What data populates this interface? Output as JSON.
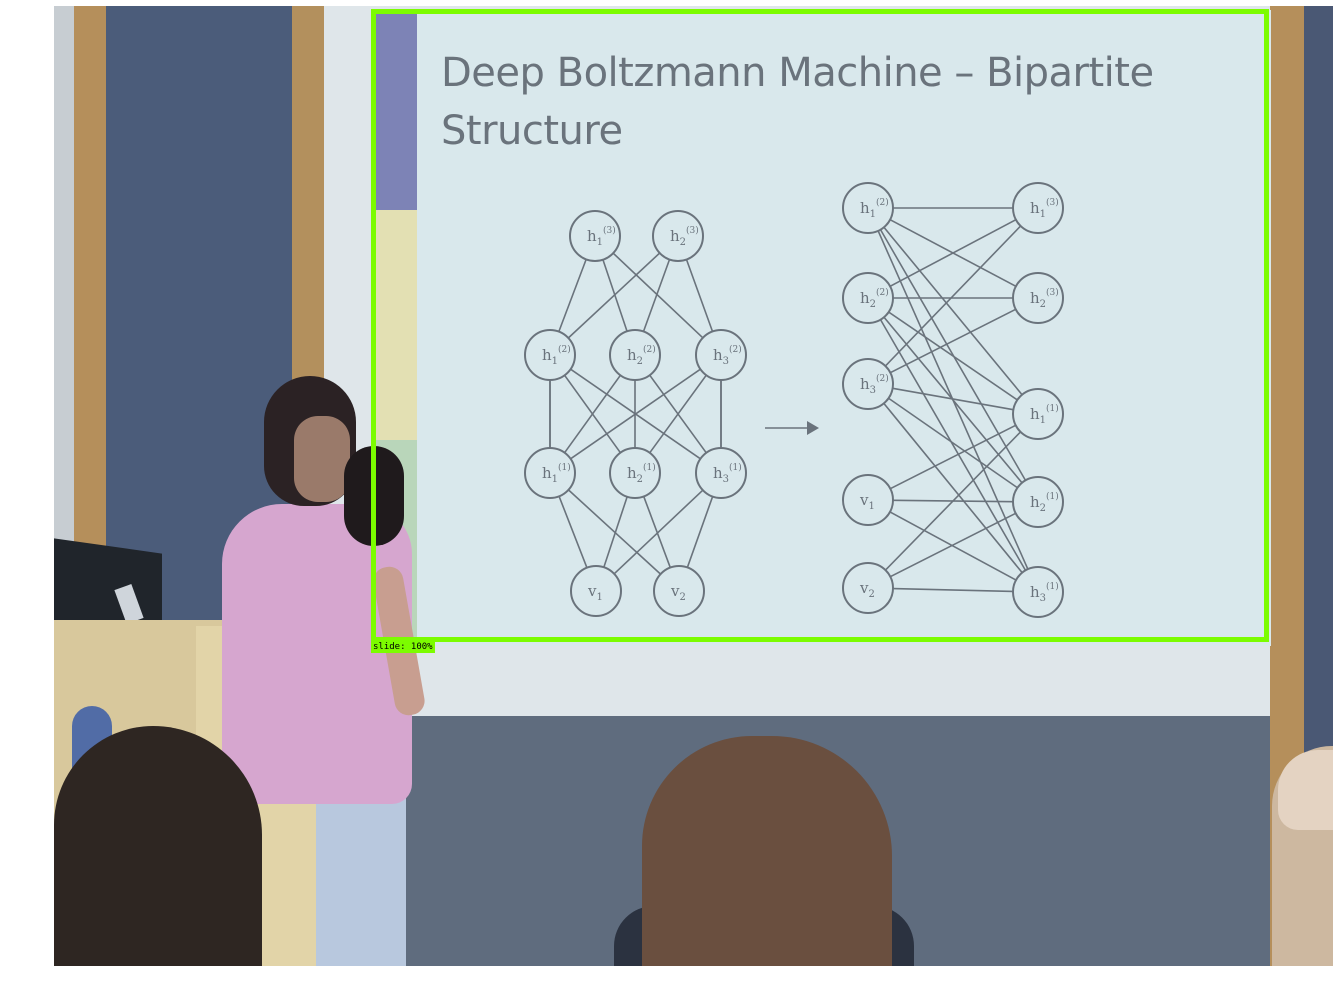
{
  "slide": {
    "title": "Deep Boltzmann Machine – Bipartite Structure",
    "title_line1": "Deep Boltzmann Machine – Bipartite",
    "title_line2": "Structure",
    "left_graph_nodes": [
      {
        "id": "h1_3",
        "label": "h",
        "sub": "1",
        "sup": "(3)"
      },
      {
        "id": "h2_3",
        "label": "h",
        "sub": "2",
        "sup": "(3)"
      },
      {
        "id": "h1_2",
        "label": "h",
        "sub": "1",
        "sup": "(2)"
      },
      {
        "id": "h2_2",
        "label": "h",
        "sub": "2",
        "sup": "(2)"
      },
      {
        "id": "h3_2",
        "label": "h",
        "sub": "3",
        "sup": "(2)"
      },
      {
        "id": "h1_1",
        "label": "h",
        "sub": "1",
        "sup": "(1)"
      },
      {
        "id": "h2_1",
        "label": "h",
        "sub": "2",
        "sup": "(1)"
      },
      {
        "id": "h3_1",
        "label": "h",
        "sub": "3",
        "sup": "(1)"
      },
      {
        "id": "v1",
        "label": "v",
        "sub": "1",
        "sup": ""
      },
      {
        "id": "v2",
        "label": "v",
        "sub": "2",
        "sup": ""
      }
    ],
    "right_graph_left_nodes": [
      {
        "id": "h1_2",
        "label": "h",
        "sub": "1",
        "sup": "(2)"
      },
      {
        "id": "h2_2",
        "label": "h",
        "sub": "2",
        "sup": "(2)"
      },
      {
        "id": "h3_2",
        "label": "h",
        "sub": "3",
        "sup": "(2)"
      },
      {
        "id": "v1",
        "label": "v",
        "sub": "1",
        "sup": ""
      },
      {
        "id": "v2",
        "label": "v",
        "sub": "2",
        "sup": ""
      }
    ],
    "right_graph_right_nodes": [
      {
        "id": "h1_3",
        "label": "h",
        "sub": "1",
        "sup": "(3)"
      },
      {
        "id": "h2_3",
        "label": "h",
        "sub": "2",
        "sup": "(3)"
      },
      {
        "id": "h1_1",
        "label": "h",
        "sub": "1",
        "sup": "(1)"
      },
      {
        "id": "h2_1",
        "label": "h",
        "sub": "2",
        "sup": "(1)"
      },
      {
        "id": "h3_1",
        "label": "h",
        "sub": "3",
        "sup": "(1)"
      }
    ],
    "arrow": "→",
    "colors": {
      "background": "#d9e8ec",
      "ink": "#6a737c",
      "stripe_top": "#7d83b6",
      "stripe_mid": "#e3e0b3",
      "stripe_bottom": "#b9d6ba"
    }
  },
  "detection": {
    "label": "slide: 100%",
    "color": "#7cfc00"
  }
}
